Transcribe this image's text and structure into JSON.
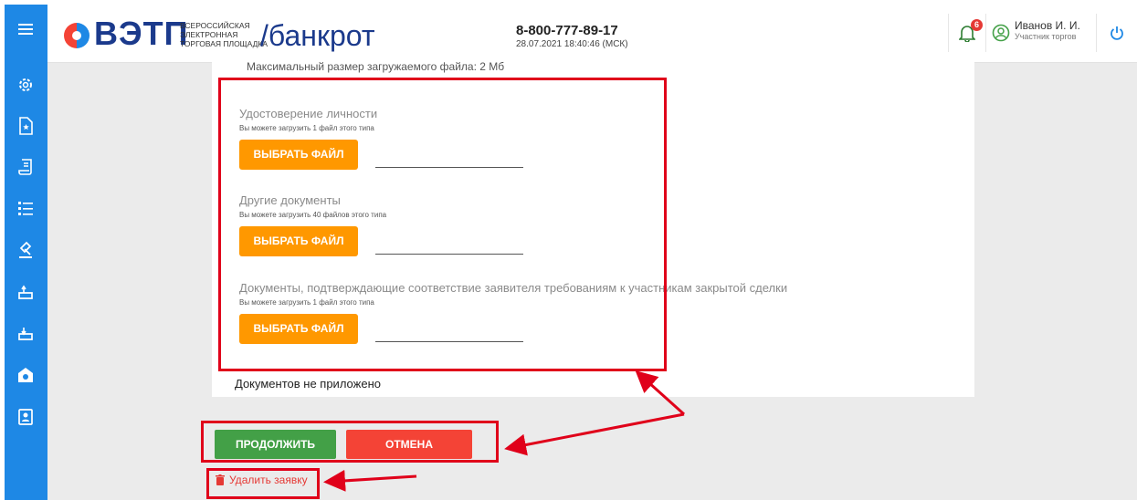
{
  "header": {
    "logo": "ВЭТП",
    "logo_sub": [
      "ВСЕРОССИЙСКАЯ",
      "ЭЛЕКТРОННАЯ",
      "ТОРГОВАЯ ПЛОЩАДКА"
    ],
    "section": "/банкрот",
    "phone": "8-800-777-89-17",
    "datetime": "28.07.2021 18:40:46 (МСК)",
    "notifications_count": "6",
    "user_name": "Иванов И. И.",
    "user_role": "Участник торгов"
  },
  "sidebar": {
    "icons": [
      "menu-icon",
      "settings-icon",
      "document-star-icon",
      "scroll-icon",
      "list-icon",
      "gavel-icon",
      "bid-up-icon",
      "bid-down-icon",
      "bank-icon",
      "contacts-icon"
    ]
  },
  "form": {
    "max_size": "Максимальный размер загружаемого файла: 2 Мб",
    "documents": [
      {
        "title": "Удостоверение личности",
        "hint": "Вы можете загрузить 1 файл этого типа",
        "button": "ВЫБРАТЬ ФАЙЛ"
      },
      {
        "title": "Другие документы",
        "hint": "Вы можете загрузить 40 файлов этого типа",
        "button": "ВЫБРАТЬ ФАЙЛ"
      },
      {
        "title": "Документы, подтверждающие соответствие заявителя требованиям к участникам закрытой сделки",
        "hint": "Вы можете загрузить 1 файл этого типа",
        "button": "ВЫБРАТЬ ФАЙЛ"
      }
    ],
    "no_documents": "Документов не приложено"
  },
  "actions": {
    "continue": "ПРОДОЛЖИТЬ",
    "cancel": "ОТМЕНА",
    "delete": "Удалить заявку"
  },
  "colors": {
    "sidebar": "#1e88e5",
    "file_button": "#ff9800",
    "continue": "#43a047",
    "cancel": "#f44336",
    "annotation": "#e0001a"
  }
}
